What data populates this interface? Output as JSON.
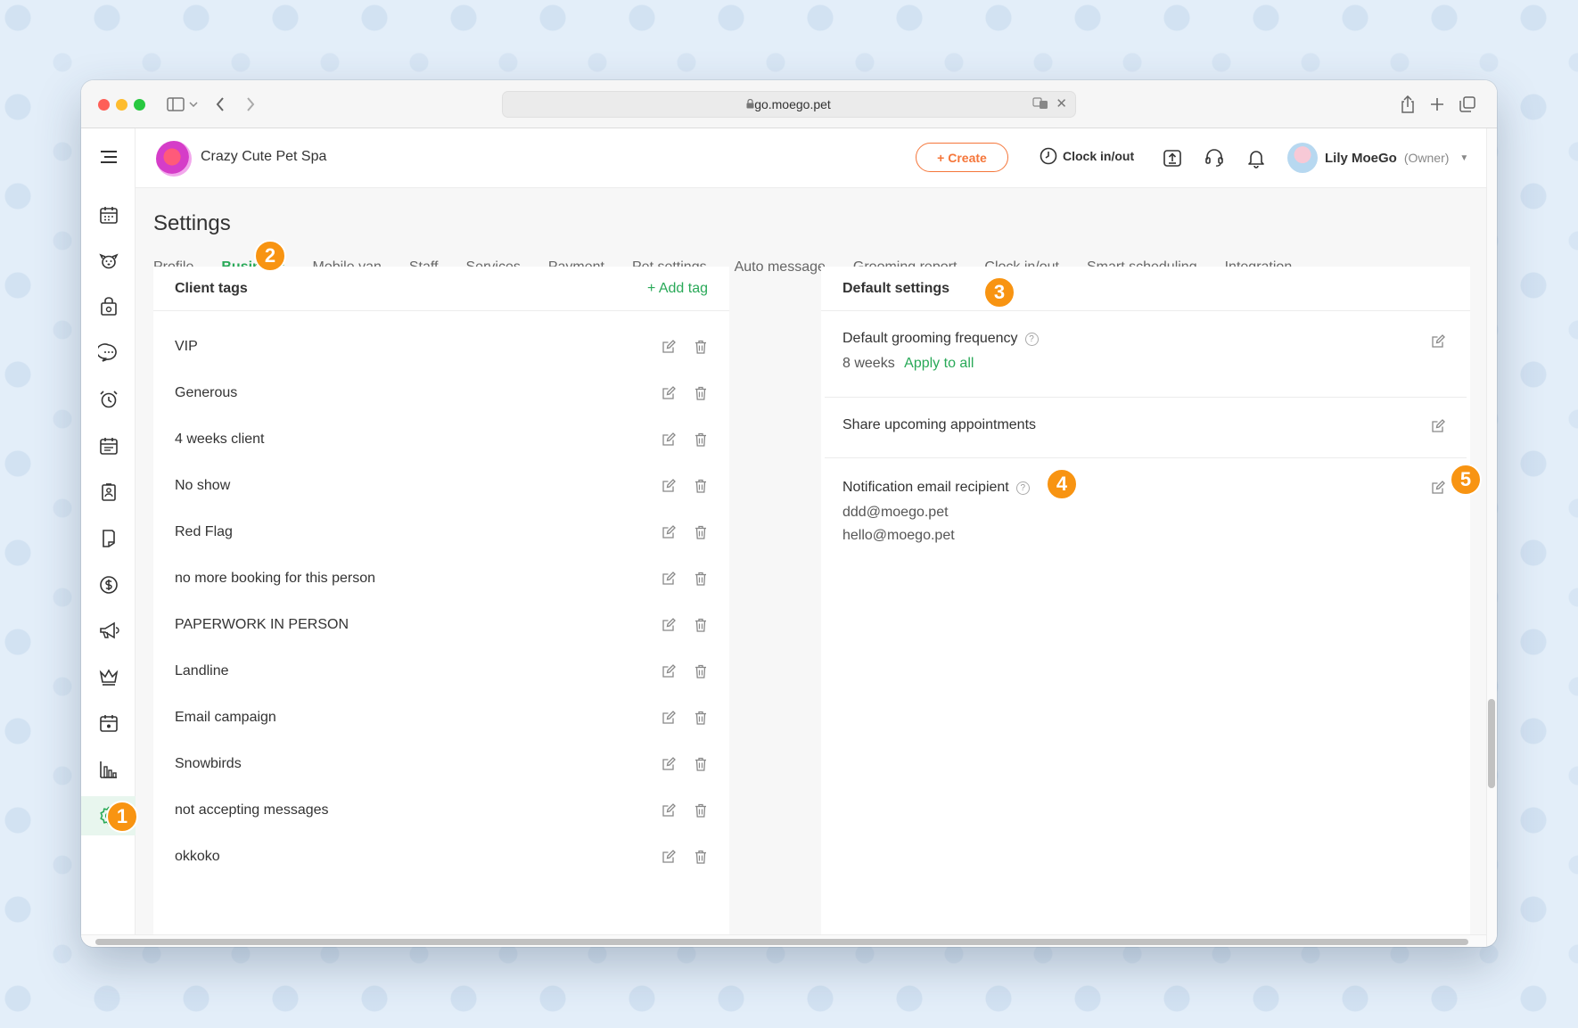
{
  "browser": {
    "url": "go.moego.pet"
  },
  "header": {
    "business_name": "Crazy Cute Pet Spa",
    "create_label": "+ Create",
    "clock_label": "Clock in/out",
    "user_name": "Lily MoeGo",
    "user_role": "(Owner)"
  },
  "nav": {
    "items": [
      {
        "name": "calendar-icon"
      },
      {
        "name": "pet-icon"
      },
      {
        "name": "store-icon"
      },
      {
        "name": "message-icon"
      },
      {
        "name": "alarm-icon"
      },
      {
        "name": "schedule-icon"
      },
      {
        "name": "contact-card-icon"
      },
      {
        "name": "document-icon"
      },
      {
        "name": "dollar-icon"
      },
      {
        "name": "megaphone-icon"
      },
      {
        "name": "crown-icon"
      },
      {
        "name": "calendar-alt-icon"
      },
      {
        "name": "bar-chart-icon"
      },
      {
        "name": "settings-gear-icon"
      }
    ]
  },
  "page": {
    "title": "Settings",
    "tabs": [
      {
        "label": "Profile"
      },
      {
        "label": "Business"
      },
      {
        "label": "Mobile van"
      },
      {
        "label": "Staff"
      },
      {
        "label": "Services"
      },
      {
        "label": "Payment"
      },
      {
        "label": "Pet settings"
      },
      {
        "label": "Auto message"
      },
      {
        "label": "Grooming report"
      },
      {
        "label": "Clock in/out"
      },
      {
        "label": "Smart scheduling"
      },
      {
        "label": "Integration"
      }
    ]
  },
  "client_tags": {
    "title": "Client tags",
    "add_label": "+ Add tag",
    "tags": [
      "VIP",
      "Generous",
      "4 weeks client",
      "No show",
      "Red Flag",
      "no more booking for this person",
      "PAPERWORK IN PERSON",
      "Landline",
      "Email campaign",
      "Snowbirds",
      "not accepting messages",
      "okkoko"
    ]
  },
  "default_settings": {
    "title": "Default settings",
    "grooming_frequency": {
      "label": "Default grooming frequency",
      "value": "8 weeks",
      "apply_label": "Apply to all"
    },
    "share_upcoming": {
      "label": "Share upcoming appointments"
    },
    "notification_email": {
      "label": "Notification email recipient",
      "emails": [
        "ddd@moego.pet",
        "hello@moego.pet"
      ]
    }
  },
  "badges": [
    "1",
    "2",
    "3",
    "4",
    "5"
  ],
  "colors": {
    "accent_green": "#29a958",
    "create_orange": "#f5763a",
    "badge_orange": "#f89412"
  }
}
